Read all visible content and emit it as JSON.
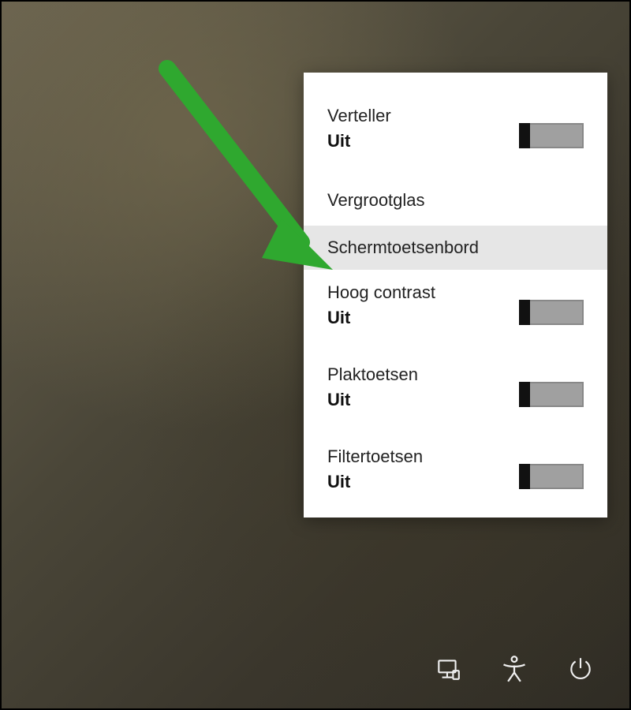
{
  "accessibility_menu": {
    "items": [
      {
        "label": "Verteller",
        "status": "Uit",
        "has_toggle": true,
        "highlighted": false
      },
      {
        "label": "Vergrootglas",
        "status": null,
        "has_toggle": false,
        "highlighted": false
      },
      {
        "label": "Schermtoetsenbord",
        "status": null,
        "has_toggle": false,
        "highlighted": true
      },
      {
        "label": "Hoog contrast",
        "status": "Uit",
        "has_toggle": true,
        "highlighted": false
      },
      {
        "label": "Plaktoetsen",
        "status": "Uit",
        "has_toggle": true,
        "highlighted": false
      },
      {
        "label": "Filtertoetsen",
        "status": "Uit",
        "has_toggle": true,
        "highlighted": false
      }
    ]
  },
  "system_icons": {
    "network": "network-icon",
    "ease_of_access": "accessibility-icon",
    "power": "power-icon"
  },
  "annotation": {
    "color": "#2fa82f"
  }
}
